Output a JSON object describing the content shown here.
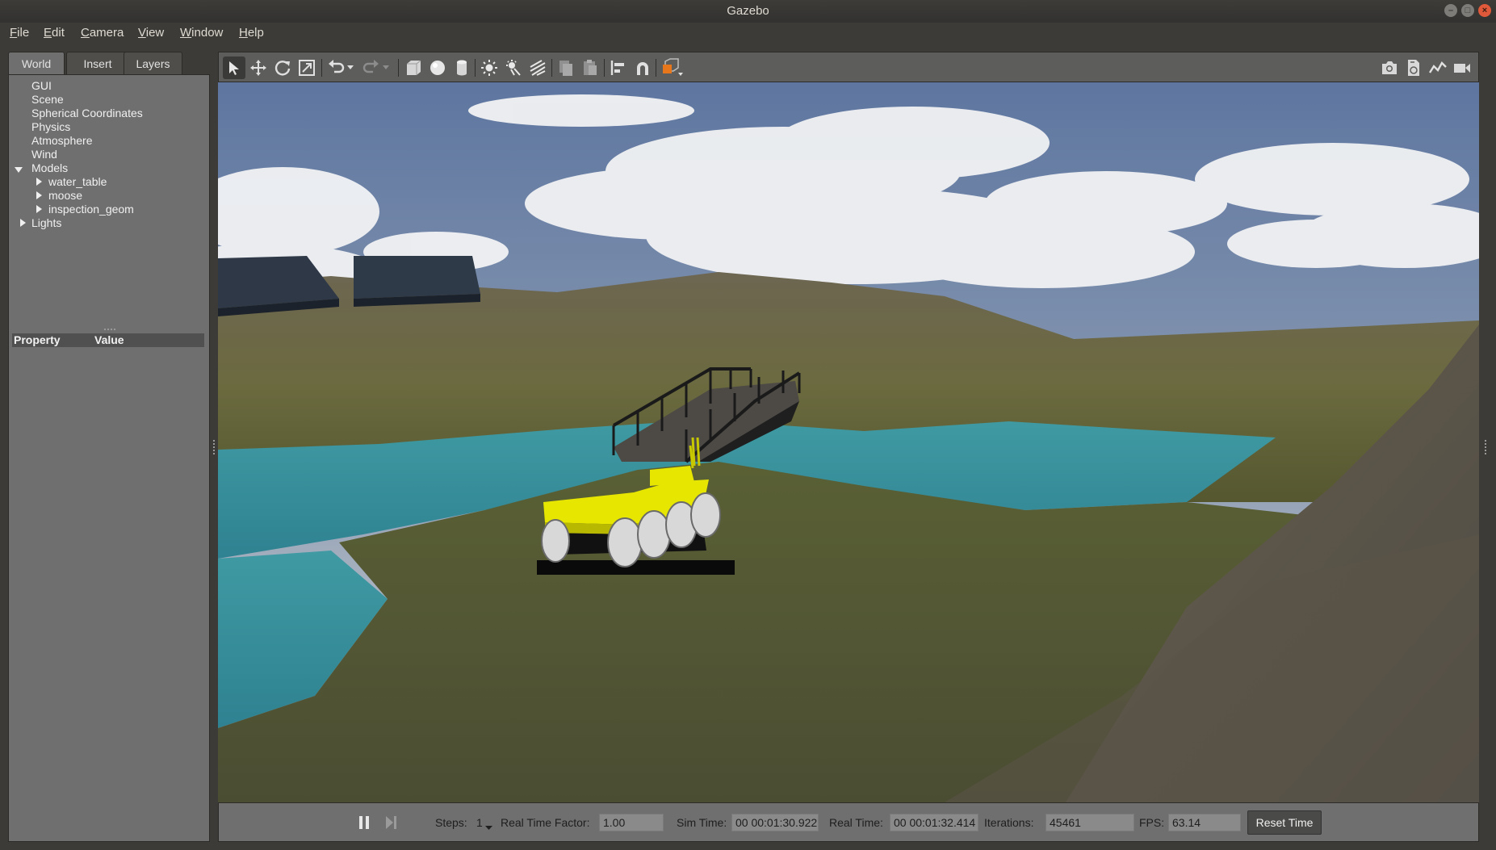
{
  "window": {
    "title": "Gazebo"
  },
  "menu": [
    "File",
    "Edit",
    "Camera",
    "View",
    "Window",
    "Help"
  ],
  "tabs": [
    "World",
    "Insert",
    "Layers"
  ],
  "tree": {
    "items": [
      "GUI",
      "Scene",
      "Spherical Coordinates",
      "Physics",
      "Atmosphere",
      "Wind"
    ],
    "models_label": "Models",
    "models": [
      "water_table",
      "moose",
      "inspection_geom"
    ],
    "lights_label": "Lights"
  },
  "properties": {
    "property_header": "Property",
    "value_header": "Value"
  },
  "toolbar": {
    "icons": [
      "select-arrow-icon",
      "translate-icon",
      "rotate-icon",
      "scale-icon",
      "undo-icon",
      "dropdown-icon",
      "redo-icon",
      "dropdown-icon",
      "box-icon",
      "sphere-icon",
      "cylinder-icon",
      "point-light-icon",
      "spot-light-icon",
      "directional-light-icon",
      "copy-icon",
      "paste-icon",
      "align-icon",
      "snap-magnet-icon",
      "view-angle-icon",
      "screenshot-icon",
      "log-icon",
      "plot-icon",
      "video-record-icon"
    ]
  },
  "status": {
    "steps_label": "Steps:",
    "steps_value": "1",
    "rtf_label": "Real Time Factor:",
    "rtf_value": "1.00",
    "sim_time_label": "Sim Time:",
    "sim_time_value": "00 00:01:30.922",
    "real_time_label": "Real Time:",
    "real_time_value": "00 00:01:32.414",
    "iterations_label": "Iterations:",
    "iterations_value": "45461",
    "fps_label": "FPS:",
    "fps_value": "63.14",
    "reset_label": "Reset Time"
  },
  "colors": {
    "accent_orange": "#e8761a",
    "rover_yellow": "#e6e600",
    "water": "#3f9aa3"
  }
}
